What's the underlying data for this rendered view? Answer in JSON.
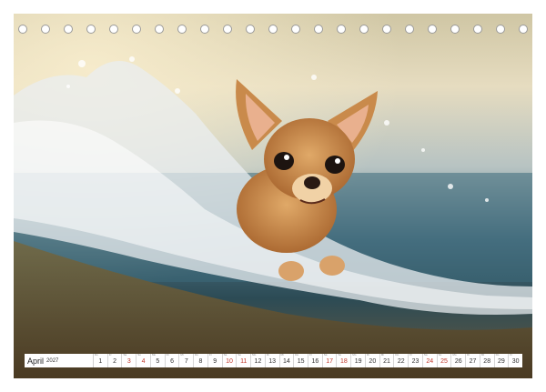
{
  "calendar": {
    "month": "April",
    "year": "2027",
    "days": [
      {
        "n": "1",
        "wd": "Do",
        "weekend": false
      },
      {
        "n": "2",
        "wd": "Fr",
        "weekend": false
      },
      {
        "n": "3",
        "wd": "Sa",
        "weekend": true
      },
      {
        "n": "4",
        "wd": "So",
        "weekend": true
      },
      {
        "n": "5",
        "wd": "Mo",
        "weekend": false
      },
      {
        "n": "6",
        "wd": "Di",
        "weekend": false
      },
      {
        "n": "7",
        "wd": "Mi",
        "weekend": false
      },
      {
        "n": "8",
        "wd": "Do",
        "weekend": false
      },
      {
        "n": "9",
        "wd": "Fr",
        "weekend": false
      },
      {
        "n": "10",
        "wd": "Sa",
        "weekend": true
      },
      {
        "n": "11",
        "wd": "So",
        "weekend": true
      },
      {
        "n": "12",
        "wd": "Mo",
        "weekend": false
      },
      {
        "n": "13",
        "wd": "Di",
        "weekend": false
      },
      {
        "n": "14",
        "wd": "Mi",
        "weekend": false
      },
      {
        "n": "15",
        "wd": "Do",
        "weekend": false
      },
      {
        "n": "16",
        "wd": "Fr",
        "weekend": false
      },
      {
        "n": "17",
        "wd": "Sa",
        "weekend": true
      },
      {
        "n": "18",
        "wd": "So",
        "weekend": true
      },
      {
        "n": "19",
        "wd": "Mo",
        "weekend": false
      },
      {
        "n": "20",
        "wd": "Di",
        "weekend": false
      },
      {
        "n": "21",
        "wd": "Mi",
        "weekend": false
      },
      {
        "n": "22",
        "wd": "Do",
        "weekend": false
      },
      {
        "n": "23",
        "wd": "Fr",
        "weekend": false
      },
      {
        "n": "24",
        "wd": "Sa",
        "weekend": true
      },
      {
        "n": "25",
        "wd": "So",
        "weekend": true
      },
      {
        "n": "26",
        "wd": "Mo",
        "weekend": false
      },
      {
        "n": "27",
        "wd": "Di",
        "weekend": false
      },
      {
        "n": "28",
        "wd": "Mi",
        "weekend": false
      },
      {
        "n": "29",
        "wd": "Do",
        "weekend": false
      },
      {
        "n": "30",
        "wd": "Fr",
        "weekend": false
      }
    ]
  },
  "colors": {
    "weekend_day": "#c0392b",
    "dog_fur": "#c98a4b",
    "water": "#3d6a7a"
  }
}
